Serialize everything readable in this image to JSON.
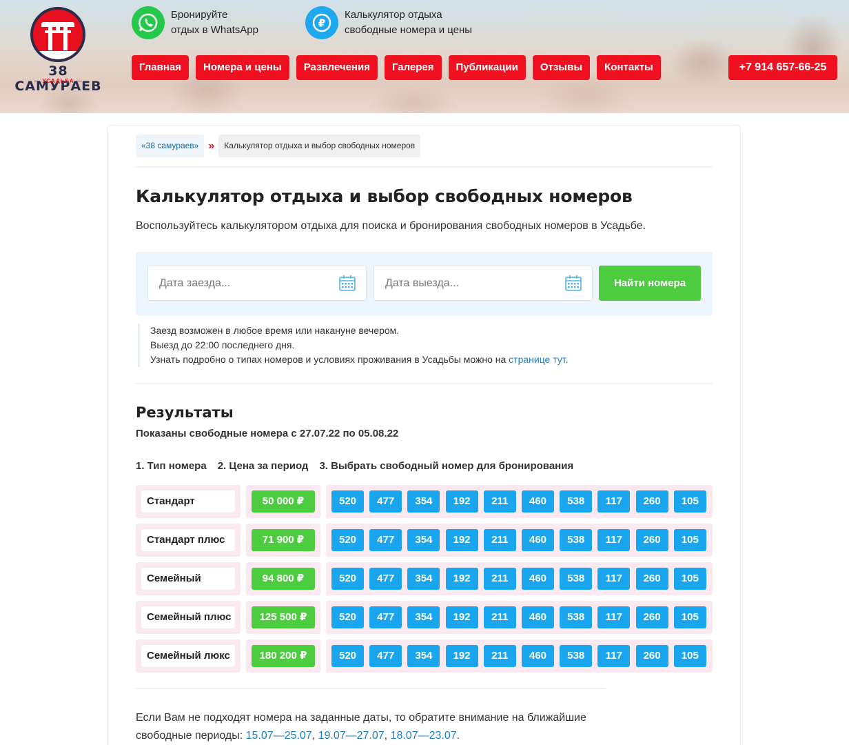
{
  "logo": {
    "name": "38 САМУРАЕВ",
    "sub": "— УСАДЬБА —"
  },
  "header_links": {
    "whatsapp": {
      "line1": "Бронируйте",
      "line2": "отдых в WhatsApp"
    },
    "calculator": {
      "line1": "Калькулятор отдыха",
      "line2": "свободные номера и цены",
      "icon_symbol": "₽"
    }
  },
  "nav": [
    "Главная",
    "Номера и цены",
    "Развлечения",
    "Галерея",
    "Публикации",
    "Отзывы",
    "Контакты"
  ],
  "phone": "+7 914 657-66-25",
  "breadcrumb": {
    "home": "«38 самураев»",
    "sep": "»",
    "current": "Калькулятор отдыха и выбор свободных номеров"
  },
  "page": {
    "title": "Калькулятор отдыха и выбор свободных номеров",
    "lead": "Воспользуйтесь калькулятором отдыха для поиска и бронирования свободных номеров в Усадьбе."
  },
  "search": {
    "checkin_placeholder": "Дата заезда...",
    "checkout_placeholder": "Дата выезда...",
    "button": "Найти номера"
  },
  "info": {
    "line1": "Заезд возможен в любое время или накануне вечером.",
    "line2": "Выезд до 22:00 последнего дня.",
    "line3_text": "Узнать подробно о типах номеров и условиях проживания в Усадьбы можно на ",
    "line3_link": "странице тут",
    "line3_end": "."
  },
  "results": {
    "title": "Результаты",
    "subtitle": "Показаны свободные номера с 27.07.22 по 05.08.22",
    "steps": [
      "1. Тип номера",
      "2. Цена за период",
      "3. Выбрать свободный номер для бронирования"
    ],
    "rows": [
      {
        "type": "Стандарт",
        "price": "50 000 ₽",
        "rooms": [
          "520",
          "477",
          "354",
          "192",
          "211",
          "460",
          "538",
          "117",
          "260",
          "105"
        ]
      },
      {
        "type": "Стандарт плюс",
        "price": "71 900 ₽",
        "rooms": [
          "520",
          "477",
          "354",
          "192",
          "211",
          "460",
          "538",
          "117",
          "260",
          "105"
        ]
      },
      {
        "type": "Семейный",
        "price": "94 800 ₽",
        "rooms": [
          "520",
          "477",
          "354",
          "192",
          "211",
          "460",
          "538",
          "117",
          "260",
          "105"
        ]
      },
      {
        "type": "Семейный плюс",
        "price": "125 500 ₽",
        "rooms": [
          "520",
          "477",
          "354",
          "192",
          "211",
          "460",
          "538",
          "117",
          "260",
          "105"
        ]
      },
      {
        "type": "Семейный люкс",
        "price": "180 200 ₽",
        "rooms": [
          "520",
          "477",
          "354",
          "192",
          "211",
          "460",
          "538",
          "117",
          "260",
          "105"
        ]
      }
    ]
  },
  "bottom": {
    "text1": "Если Вам не подходят номера на заданные даты, то обратите внимание на ближайшие свободные периоды: ",
    "periods": [
      "15.07—25.07",
      "19.07—27.07",
      "18.07—23.07"
    ],
    "end": "."
  },
  "colors": {
    "brand_red": "#f01020",
    "green": "#4ccc3e",
    "blue": "#1aa6ee",
    "row_bg": "#fbe9f2",
    "search_bg": "#edf6fc"
  }
}
